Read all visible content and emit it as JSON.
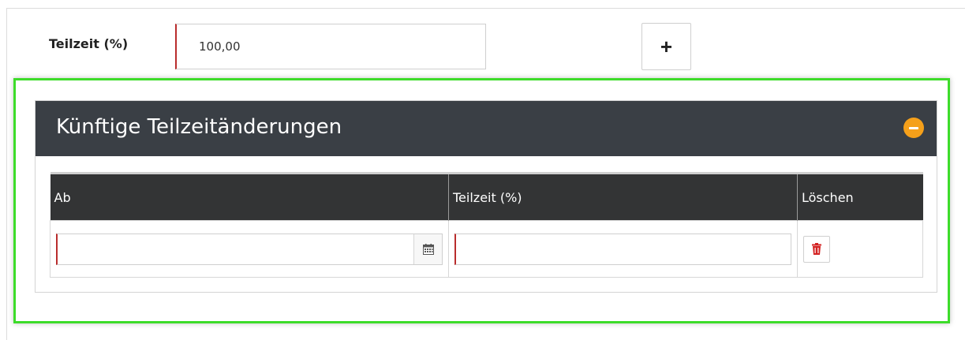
{
  "form": {
    "teilzeit_label": "Teilzeit (%)",
    "teilzeit_value": "100,00",
    "add_button_label": "+"
  },
  "panel": {
    "title": "Künftige Teilzeitänderungen",
    "collapse_icon": "minus-circle-icon",
    "accent_color": "#f5a01a",
    "header_color": "#3a3f45"
  },
  "table": {
    "columns": [
      "Ab",
      "Teilzeit (%)",
      "Löschen"
    ],
    "rows": [
      {
        "ab": "",
        "teilzeit": "",
        "calendar_icon": "calendar-icon",
        "delete_icon": "trash-icon"
      }
    ]
  },
  "colors": {
    "highlight_border": "#3ddc2a",
    "required_marker": "#b92d2d",
    "delete_icon": "#d32222"
  }
}
